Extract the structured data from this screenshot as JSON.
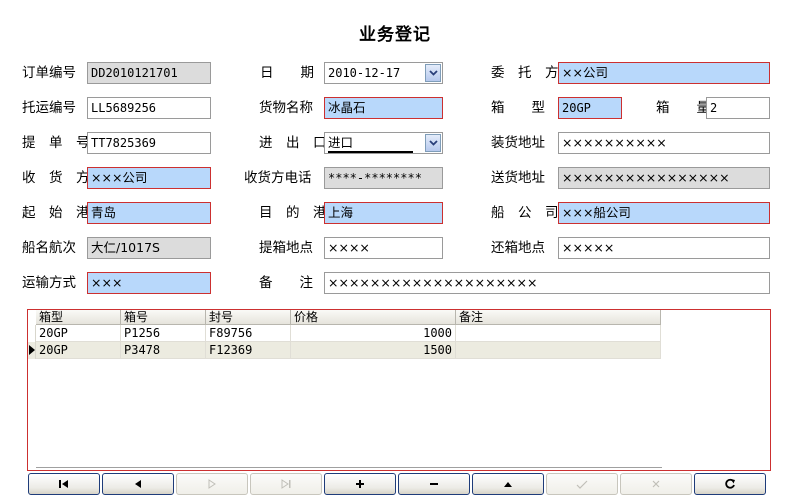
{
  "form": {
    "title": "业务登记",
    "labels": {
      "order_no": "订单编号",
      "date": "日　　期",
      "client": "委　托　方",
      "consign_no": "托运编号",
      "goods_name": "货物名称",
      "box_type": "箱　　型",
      "box_qty": "箱　　量",
      "bl_no": "提　单　号",
      "import_export": "进　出　口",
      "load_addr": "装货地址",
      "consignee": "收　货　方",
      "consignee_phone": "收货方电话",
      "delivery_addr": "送货地址",
      "origin_port": "起　始　港",
      "dest_port": "目　的　港",
      "shipping_co": "船　公　司",
      "vessel_voyage": "船名航次",
      "pickup_point": "提箱地点",
      "return_point": "还箱地点",
      "transport_mode": "运输方式",
      "remarks": "备　　注"
    },
    "values": {
      "order_no": "DD2010121701",
      "date": "2010-12-17",
      "client": "××公司",
      "consign_no": "LL5689256",
      "goods_name": "冰晶石",
      "box_type": "20GP",
      "box_qty": "2",
      "bl_no": "TT7825369",
      "import_export": "进口",
      "load_addr": "××××××××××",
      "consignee": "×××公司",
      "consignee_phone": "****-********",
      "delivery_addr": "××××××××××××××××",
      "origin_port": "青岛",
      "dest_port": "上海",
      "shipping_co": "×××船公司",
      "vessel_voyage": "大仁/1017S",
      "pickup_point": "××××",
      "return_point": "×××××",
      "transport_mode": "×××",
      "remarks": "××××××××××××××××××××"
    }
  },
  "grid": {
    "columns": [
      "箱型",
      "箱号",
      "封号",
      "价格",
      "备注"
    ],
    "rows": [
      {
        "box_type": "20GP",
        "box_no": "P1256",
        "seal_no": "F89756",
        "price": "1000",
        "note": ""
      },
      {
        "box_type": "20GP",
        "box_no": "P3478",
        "seal_no": "F12369",
        "price": "1500",
        "note": ""
      }
    ]
  },
  "navigator": {
    "buttons": [
      {
        "name": "first-record-button",
        "icon": "first-icon",
        "enabled": true
      },
      {
        "name": "prior-record-button",
        "icon": "prior-icon",
        "enabled": true
      },
      {
        "name": "next-record-button",
        "icon": "next-icon",
        "enabled": false
      },
      {
        "name": "last-record-button",
        "icon": "last-icon",
        "enabled": false
      },
      {
        "name": "insert-button",
        "icon": "plus-icon",
        "enabled": true
      },
      {
        "name": "delete-button",
        "icon": "minus-icon",
        "enabled": true
      },
      {
        "name": "edit-button",
        "icon": "up-triangle-icon",
        "enabled": true
      },
      {
        "name": "post-button",
        "icon": "check-icon",
        "enabled": false
      },
      {
        "name": "cancel-button",
        "icon": "cancel-icon",
        "enabled": false
      },
      {
        "name": "refresh-button",
        "icon": "refresh-icon",
        "enabled": true
      }
    ]
  },
  "colors": {
    "required_field_bg": "#b8d8fb",
    "required_field_border": "#cc3030",
    "readonly_field_bg": "#dcdcdc",
    "grid_alt_row": "#ecebe0"
  }
}
